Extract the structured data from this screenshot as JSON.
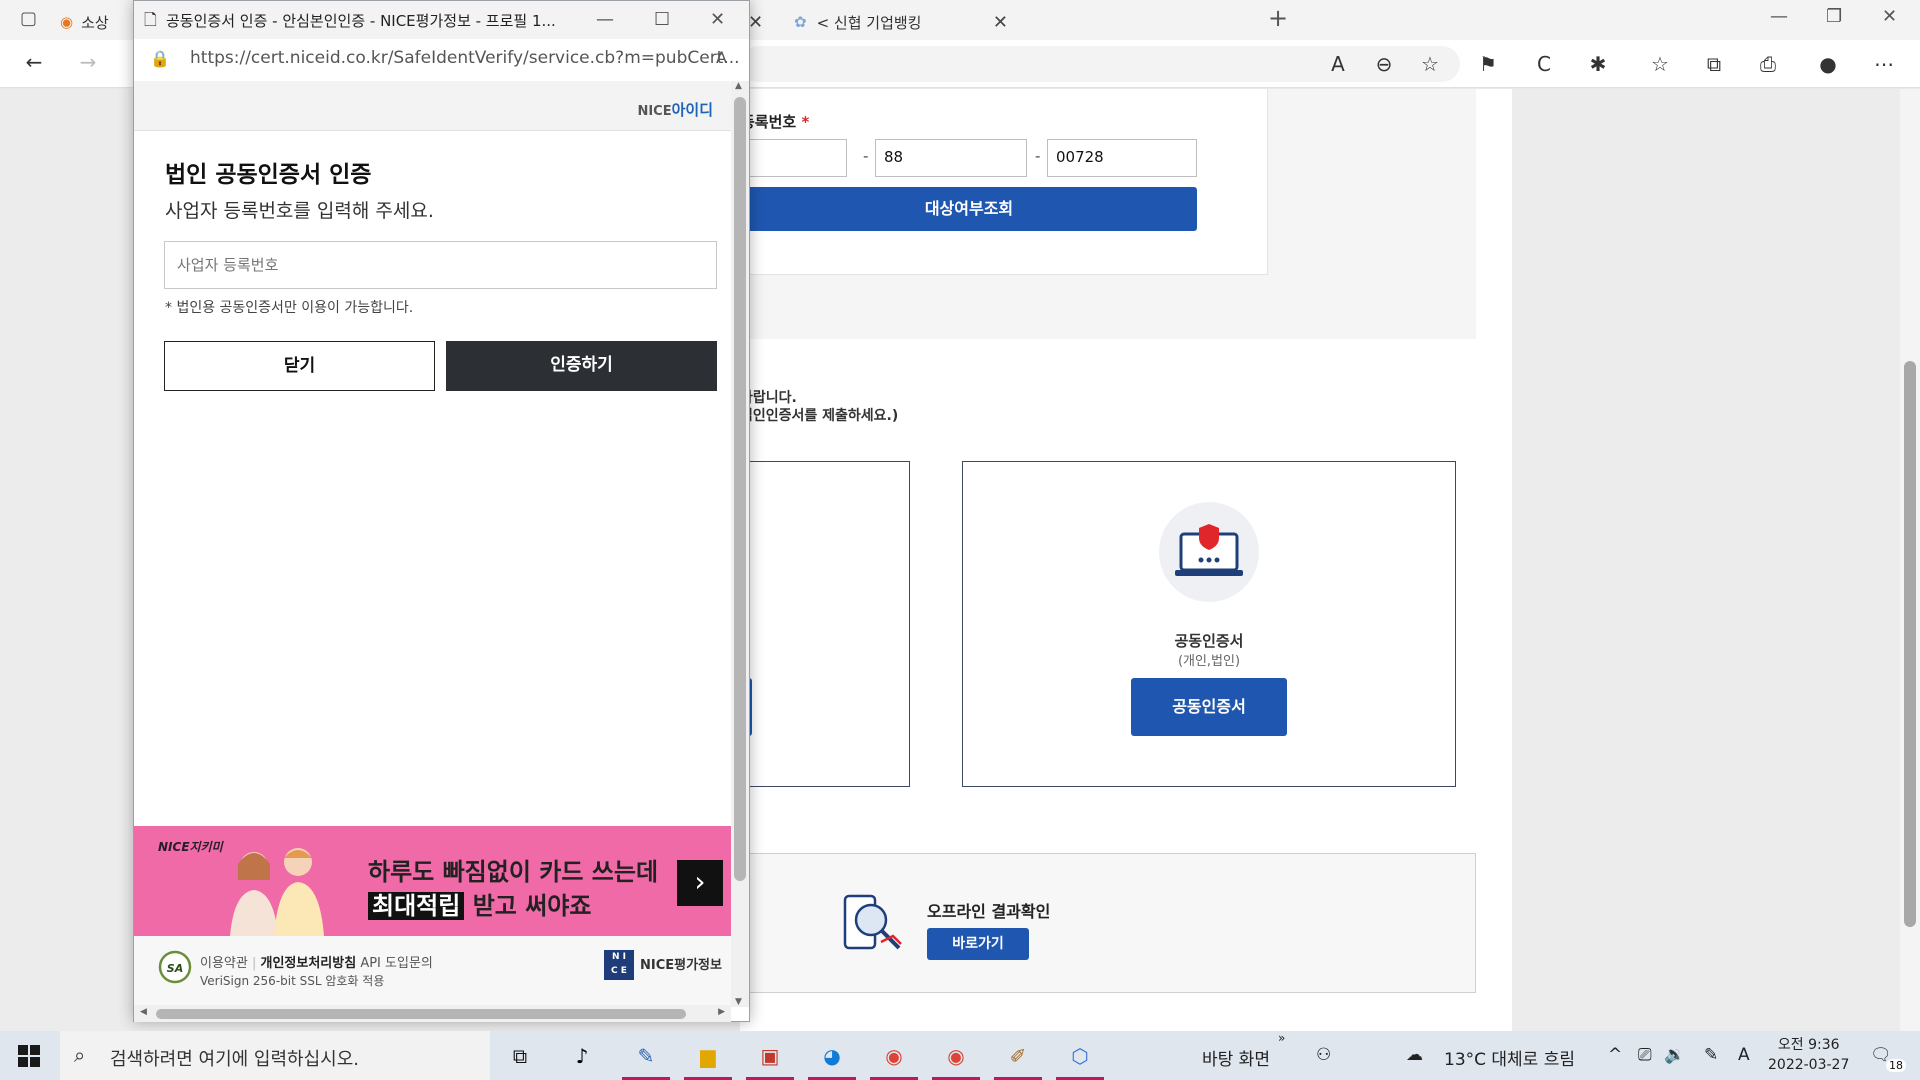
{
  "browser": {
    "tabs": [
      {
        "title": "소상"
      },
      {
        "title": "< 신협 기업뱅킹"
      }
    ]
  },
  "popup": {
    "window_title": "공동인증서 인증 - 안심본인인증 - NICE평가정보 - 프로필 1...",
    "url": "https://cert.niceid.co.kr/SafeIdentVerify/service.cb?m=pubCert...",
    "logo_prefix": "NICE",
    "logo_korean": "아이디",
    "heading": "법인 공동인증서 인증",
    "subheading": "사업자 등록번호를 입력해 주세요.",
    "input_placeholder": "사업자 등록번호",
    "note": "* 법인용 공동인증서만 이용이 가능합니다.",
    "close_button": "닫기",
    "auth_button": "인증하기",
    "banner": {
      "brand": "NICE지키미",
      "line1": "하루도 빠짐없이 카드 쓰는데",
      "highlight": "최대적립",
      "line2_rest": "받고 써야죠"
    },
    "footer": {
      "terms": "이용약관",
      "privacy": "개인정보처리방침",
      "api": "API 도입문의",
      "ssl": "VeriSign 256-bit SSL 암호화 적용",
      "company": "NICE평가정보"
    }
  },
  "page": {
    "biz_label": "등록번호",
    "required_mark": "*",
    "field_middle": "88",
    "field_last": "00728",
    "dash": "-",
    "lookup_button": "대상여부조회",
    "notice_1": "바랍니다.",
    "notice_2": "법인인증서를 제출하세요.)",
    "cert_card": {
      "title": "공동인증서",
      "subtitle": "(개인,법인)",
      "button": "공동인증서"
    },
    "offline": {
      "title": "오프라인 결과확인",
      "button": "바로가기"
    }
  },
  "taskbar": {
    "search_placeholder": "검색하려면 여기에 입력하십시오.",
    "desktop_label": "바탕 화면",
    "weather": "13°C  대체로 흐림",
    "ime": "A",
    "time": "오전 9:36",
    "date": "2022-03-27",
    "notifications": "18"
  },
  "colors": {
    "primary_blue": "#1f57b0",
    "dark_button": "#2c2f33",
    "banner_pink": "#f06aa8",
    "required_red": "#e0262b"
  }
}
